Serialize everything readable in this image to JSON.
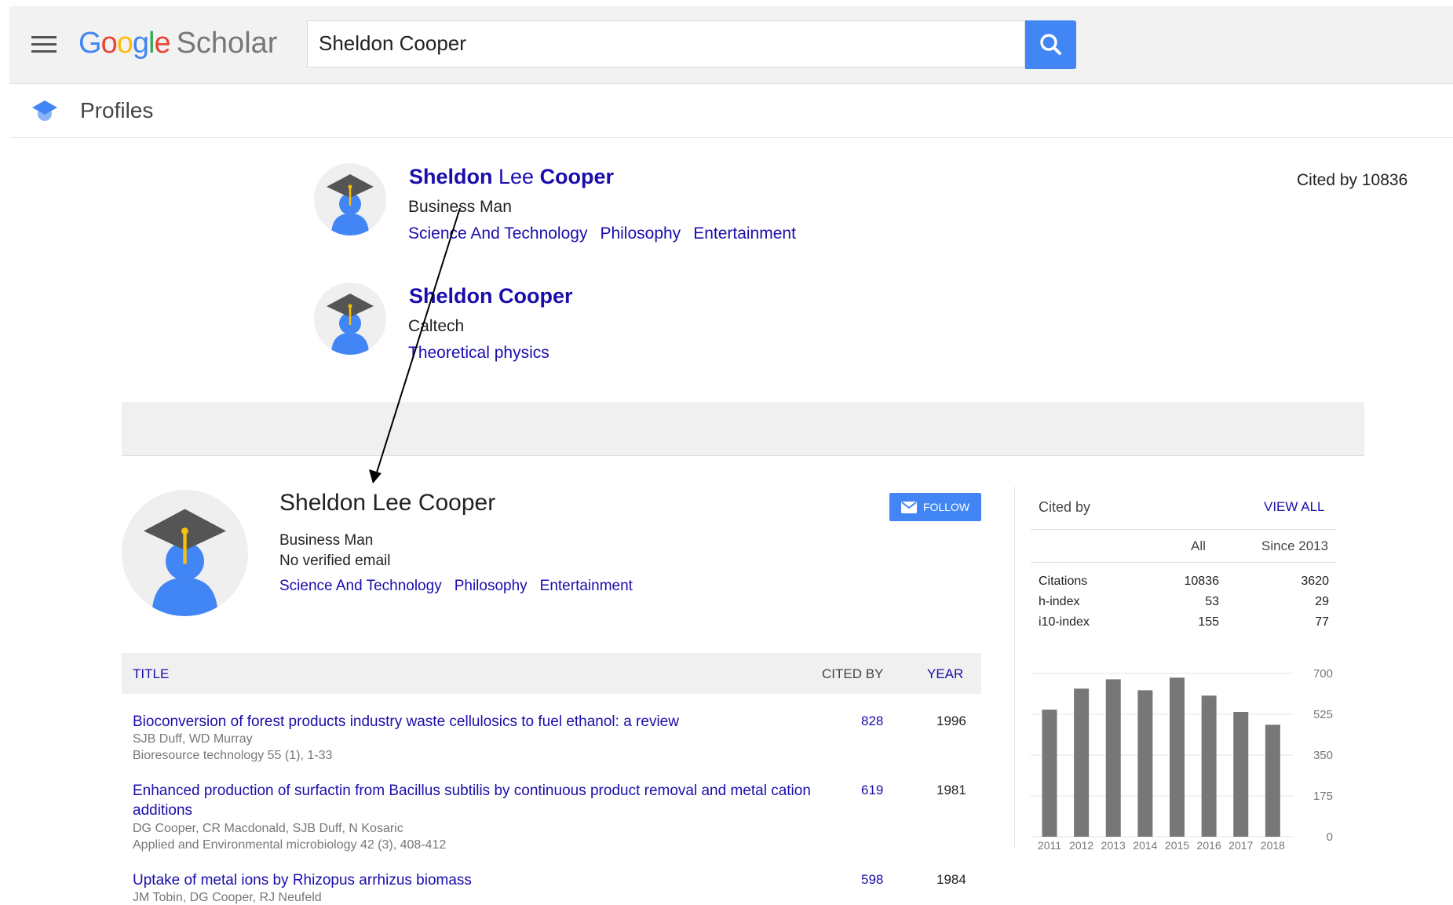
{
  "header": {
    "logo_google": [
      "G",
      "o",
      "o",
      "g",
      "l",
      "e"
    ],
    "logo_scholar": "Scholar",
    "search_value": "Sheldon Cooper"
  },
  "subbar": {
    "label": "Profiles"
  },
  "results": [
    {
      "name_parts": [
        "Sheldon",
        " Lee ",
        "Cooper"
      ],
      "affiliation": "Business Man",
      "interests": [
        "Science And Technology",
        "Philosophy",
        "Entertainment"
      ],
      "cited_by": "Cited by 10836"
    },
    {
      "name_parts": [
        "Sheldon",
        " ",
        "Cooper"
      ],
      "affiliation": "Caltech",
      "interests": [
        "Theoretical physics"
      ]
    }
  ],
  "profile": {
    "name": "Sheldon Lee Cooper",
    "affiliation": "Business Man",
    "email": "No verified email",
    "interests": [
      "Science And Technology",
      "Philosophy",
      "Entertainment"
    ],
    "follow_label": "FOLLOW"
  },
  "table": {
    "headers": {
      "title": "TITLE",
      "cited_by": "CITED BY",
      "year": "YEAR"
    },
    "rows": [
      {
        "title": "Bioconversion of forest products industry waste cellulosics to fuel ethanol: a review",
        "authors": "SJB Duff, WD Murray",
        "venue": "Bioresource technology 55 (1), 1-33",
        "cited_by": "828",
        "year": "1996"
      },
      {
        "title": "Enhanced production of surfactin from Bacillus subtilis by continuous product removal and metal cation additions",
        "authors": "DG Cooper, CR Macdonald, SJB Duff, N Kosaric",
        "venue": "Applied and Environmental microbiology 42 (3), 408-412",
        "cited_by": "619",
        "year": "1981"
      },
      {
        "title": "Uptake of metal ions by Rhizopus arrhizus biomass",
        "authors": "JM Tobin, DG Cooper, RJ Neufeld",
        "cited_by": "598",
        "year": "1984"
      }
    ]
  },
  "cited_panel": {
    "heading": "Cited by",
    "view_all": "VIEW ALL",
    "col_all": "All",
    "col_since": "Since 2013",
    "rows": [
      {
        "label": "Citations",
        "all": "10836",
        "since": "3620"
      },
      {
        "label": "h-index",
        "all": "53",
        "since": "29"
      },
      {
        "label": "i10-index",
        "all": "155",
        "since": "77"
      }
    ]
  },
  "chart_data": {
    "type": "bar",
    "categories": [
      "2011",
      "2012",
      "2013",
      "2014",
      "2015",
      "2016",
      "2017",
      "2018"
    ],
    "values": [
      545,
      635,
      675,
      628,
      682,
      605,
      535,
      480
    ],
    "yticks": [
      700,
      525,
      350,
      175,
      0
    ],
    "ylim": [
      0,
      700
    ],
    "bar_color": "#777777",
    "grid": true
  },
  "colors": {
    "accent": "#4285f4",
    "link": "#1a0dab"
  }
}
